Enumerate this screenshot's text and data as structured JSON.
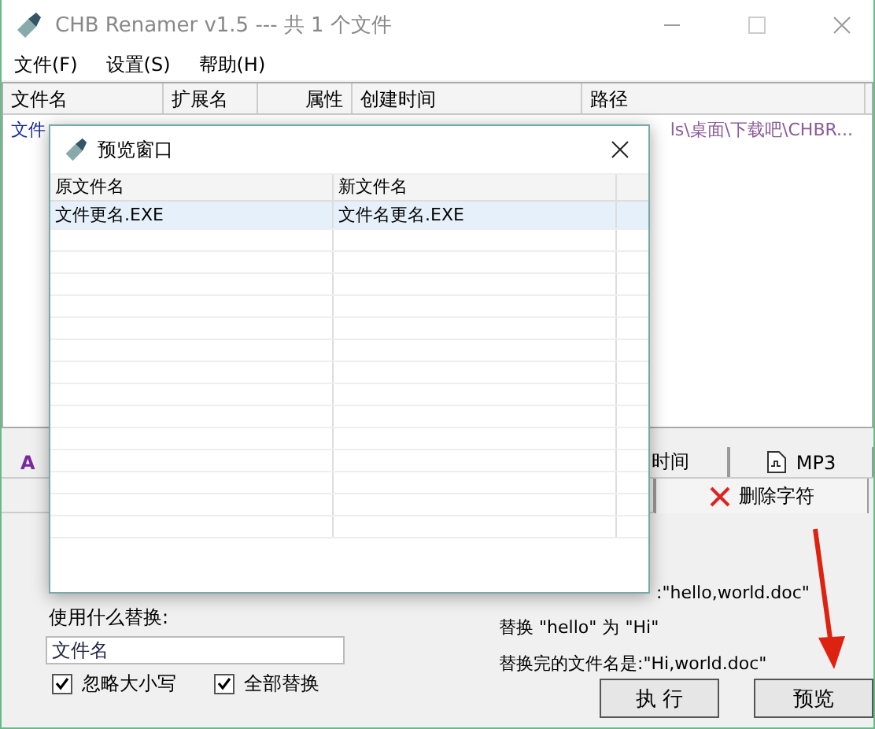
{
  "window": {
    "title": "CHB Renamer v1.5 --- 共 1 个文件"
  },
  "menu": [
    "文件(F)",
    "设置(S)",
    "帮助(H)"
  ],
  "file_list": {
    "columns": [
      "文件名",
      "扩展名",
      "属性",
      "创建时间",
      "路径"
    ],
    "rows": [
      {
        "name": "文件",
        "path": "ls\\桌面\\下载吧\\CHBR..."
      }
    ]
  },
  "tabs_row1": [
    {
      "label": "A",
      "kind": "text"
    },
    {
      "label": "时间",
      "kind": "text"
    },
    {
      "label": "MP3",
      "kind": "mp3"
    }
  ],
  "tabs_row2": [
    {
      "label": "删除字符",
      "kind": "delete",
      "selected": true
    }
  ],
  "example": {
    "line1": ":\"hello,world.doc\"",
    "line2": "替换 \"hello\" 为 \"Hi\"",
    "line3": "替换完的文件名是:\"Hi,world.doc\""
  },
  "replace_with": {
    "label": "使用什么替换:",
    "value": "文件名"
  },
  "options": [
    {
      "label": "忽略大小写",
      "checked": true
    },
    {
      "label": "全部替换",
      "checked": true
    }
  ],
  "buttons": [
    "执 行",
    "预览"
  ],
  "preview_dialog": {
    "title": "预览窗口",
    "columns": [
      "原文件名",
      "新文件名"
    ],
    "rows": [
      {
        "old": "文件更名.EXE",
        "new": "文件名更名.EXE"
      }
    ]
  }
}
